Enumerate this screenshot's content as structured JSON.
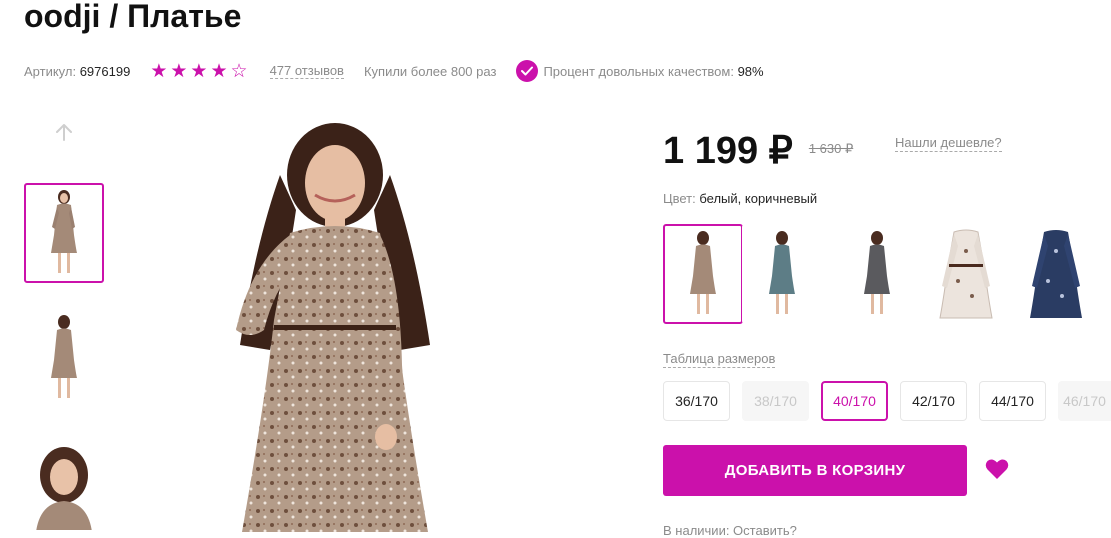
{
  "product": {
    "title": "oodji / Платье",
    "article_label": "Артикул:",
    "article_value": "6976199",
    "rating": 4,
    "reviews": "477 отзывов",
    "bought": "Купили более 800 раз",
    "quality_label": "Процент довольных качеством:",
    "quality_value": "98%"
  },
  "price": {
    "current": "1 199 ₽",
    "old": "1 630 ₽",
    "cheaper_link": "Нашли дешевле?"
  },
  "color": {
    "label": "Цвет:",
    "value": "белый, коричневый"
  },
  "sizes": {
    "table_link": "Таблица размеров",
    "items": [
      {
        "label": "36/170",
        "state": "available"
      },
      {
        "label": "38/170",
        "state": "disabled"
      },
      {
        "label": "40/170",
        "state": "selected"
      },
      {
        "label": "42/170",
        "state": "available"
      },
      {
        "label": "44/170",
        "state": "available"
      },
      {
        "label": "46/170",
        "state": "disabled"
      }
    ]
  },
  "cart": {
    "add_label": "ДОБАВИТЬ В КОРЗИНУ"
  },
  "cutoff_text": "В наличии: Оставить?",
  "colors": {
    "accent": "#cb11ab",
    "text": "#242424",
    "muted": "#8b8b8b"
  },
  "icons": {
    "up_arrow": "arrow-up-icon",
    "check": "check-icon",
    "heart": "heart-icon",
    "star": "star-icon"
  }
}
